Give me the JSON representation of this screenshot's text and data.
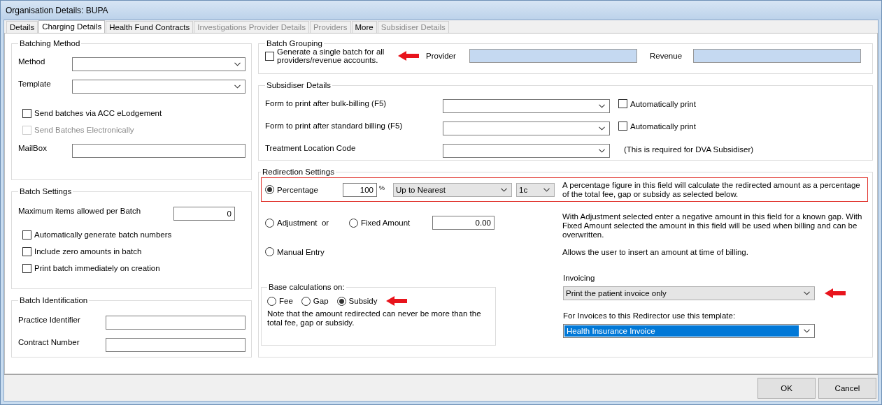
{
  "window": {
    "title": "Organisation Details: BUPA"
  },
  "tabs": [
    {
      "label": "Details",
      "selected": false,
      "disabled": false
    },
    {
      "label": "Charging Details",
      "selected": true,
      "disabled": false
    },
    {
      "label": "Health Fund Contracts",
      "selected": false,
      "disabled": false
    },
    {
      "label": "Investigations Provider Details",
      "selected": false,
      "disabled": true
    },
    {
      "label": "Providers",
      "selected": false,
      "disabled": true
    },
    {
      "label": "More",
      "selected": false,
      "disabled": false
    },
    {
      "label": "Subsidiser Details",
      "selected": false,
      "disabled": true
    }
  ],
  "batching_method": {
    "title": "Batching Method",
    "selects": [
      {
        "label": "Method"
      },
      {
        "label": "Template"
      }
    ],
    "checkboxes": [
      {
        "label": "Send batches via ACC eLodgement",
        "checked": false,
        "disabled": false
      },
      {
        "label": "Send Batches Electronically",
        "checked": false,
        "disabled": true
      }
    ],
    "mailbox": {
      "label": "MailBox"
    }
  },
  "batch_settings": {
    "title": "Batch Settings",
    "max_items": {
      "label": "Maximum items allowed per Batch",
      "value": "0"
    },
    "checkboxes": [
      {
        "label": "Automatically generate batch numbers",
        "checked": false,
        "disabled": false
      },
      {
        "label": "Include zero amounts in batch",
        "checked": false,
        "disabled": false
      },
      {
        "label": "Print batch immediately on creation",
        "checked": false,
        "disabled": false
      }
    ]
  },
  "batch_identification": {
    "title": "Batch Identification",
    "fields": [
      {
        "label": "Practice Identifier"
      },
      {
        "label": "Contract Number"
      }
    ]
  },
  "batch_grouping": {
    "title": "Batch Grouping",
    "single_batch": {
      "label": "Generate a single batch for all providers/revenue accounts.",
      "checked": false,
      "marked": true
    },
    "fields": [
      {
        "label": "Provider"
      },
      {
        "label": "Revenue"
      }
    ]
  },
  "subsidiser_details": {
    "title": "Subsidiser Details",
    "rows": [
      {
        "kind": "print",
        "label": "Form to print after bulk-billing (F5)",
        "option": {
          "label": "Automatically print",
          "checked": false,
          "disabled": false
        }
      },
      {
        "kind": "print",
        "label": "Form to print after standard billing (F5)",
        "option": {
          "label": "Automatically print",
          "checked": false,
          "disabled": false
        }
      },
      {
        "kind": "note",
        "label": "Treatment Location Code",
        "note": "(This is required for DVA Subsidiser)"
      }
    ]
  },
  "redirection_settings": {
    "title": "Redirection Settings",
    "rows": [
      {
        "kind": "percentage",
        "highlighted": true,
        "radios": [
          {
            "label": "Percentage",
            "selected": true
          }
        ],
        "value": "100",
        "unit": "%",
        "rounding": "Up to Nearest",
        "step": "1c",
        "description": "A percentage figure in this field will calculate the redirected amount as a percentage of the total fee, gap or subsidy as selected below."
      },
      {
        "kind": "amount",
        "highlighted": false,
        "radios": [
          {
            "label": "Adjustment  or",
            "selected": false
          },
          {
            "label": "Fixed Amount",
            "selected": false
          }
        ],
        "value": "0.00",
        "description": "With Adjustment selected enter a negative amount in this field for a known gap. With Fixed Amount selected the amount in this field will be used when billing and can be overwritten."
      },
      {
        "kind": "manual",
        "highlighted": false,
        "radios": [
          {
            "label": "Manual Entry",
            "selected": false
          }
        ],
        "description": "Allows the user to insert an amount at time of billing."
      }
    ],
    "base_calculations": {
      "title": "Base calculations on:",
      "marked": true,
      "options": [
        {
          "label": "Fee",
          "selected": false
        },
        {
          "label": "Gap",
          "selected": false
        },
        {
          "label": "Subsidy",
          "selected": true
        }
      ],
      "note": "Note that the amount redirected can never be more than the total fee, gap or subsidy."
    },
    "invoicing": {
      "label": "Invoicing",
      "value": "Print the patient invoice only",
      "marked": true
    },
    "template": {
      "label": "For Invoices to this Redirector use this template:",
      "value": "Health Insurance Invoice",
      "selected": true
    }
  },
  "buttons": [
    {
      "label": "OK"
    },
    {
      "label": "Cancel"
    }
  ]
}
